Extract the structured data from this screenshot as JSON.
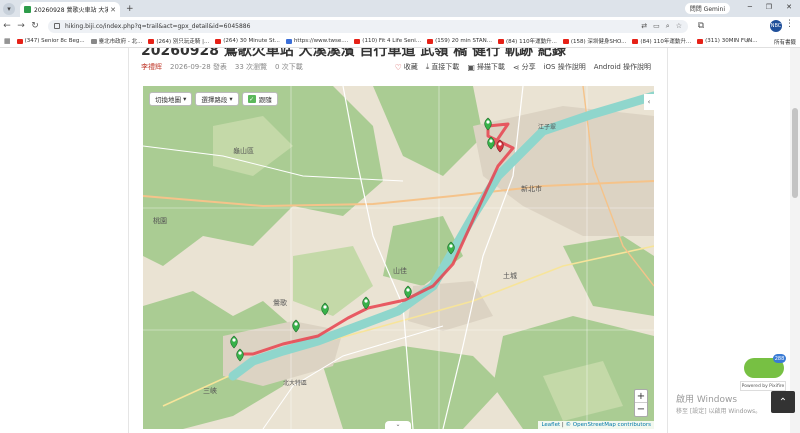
{
  "browser": {
    "tab_title": "20260928 鶯歌火車站 大溪溪濱...",
    "gemini_label": "問問 Gemini",
    "url": "hiking.biji.co/index.php?q=trail&act=gpx_detail&id=6045886",
    "profile_initials": "NBC",
    "bookmarks": [
      "(347) Senior 8c Beg...",
      "臺北市政府 - 北...",
      "(264) 別只玩走騎 |...",
      "(264) 30 Minute St...",
      "https://www.twse....",
      "(110) Fit 4 Life Seni...",
      "(159) 20 min STAN...",
      "(84) 110年運動升...",
      "(158) 深圳健身SHO...",
      "(84) 110年運動升...",
      "(311) 30MIN FUN..."
    ],
    "bookmarks_all": "所有書籤"
  },
  "page": {
    "title_fragment": "20260928 鶯歌火車站 大溪溪濱 自行車道 武嶺 橋 健行 軌跡 紀錄",
    "author": "李禮辉",
    "date": "2026-09-28 發表",
    "views": "33 次瀏覽",
    "downloads": "0 次下載",
    "actions": [
      {
        "icon": "heart-icon",
        "label": "收藏"
      },
      {
        "icon": "download-icon",
        "label": "直接下載"
      },
      {
        "icon": "qr-icon",
        "label": "掃描下載"
      },
      {
        "icon": "share-icon",
        "label": "分享"
      },
      {
        "icon": "ios-icon",
        "label": "iOS 操作說明"
      },
      {
        "icon": "android-icon",
        "label": "Android 操作說明"
      }
    ]
  },
  "map": {
    "switch_map": "切換地圖",
    "select_route": "選擇路段",
    "follow": "跟隨",
    "zoom_in": "+",
    "zoom_out": "−",
    "attribution_leaflet": "Leaflet",
    "attribution_osm": "© OpenStreetMap contributors",
    "place_labels": [
      "新北市",
      "三峽",
      "鶯歌",
      "桃園",
      "北大特區",
      "龜山區",
      "江子翠",
      "土城",
      "山佳"
    ]
  },
  "overlay": {
    "chat_badge": "288",
    "powered_by": "Powered by Pixifire",
    "activate_title": "啟用 Windows",
    "activate_sub": "移至 [設定] 以啟用 Windows。"
  },
  "colors": {
    "route": "#e8424f",
    "marker": "#38b24a",
    "river": "#8fd6cc",
    "forest": "#aacc93",
    "author": "#c0392b"
  }
}
